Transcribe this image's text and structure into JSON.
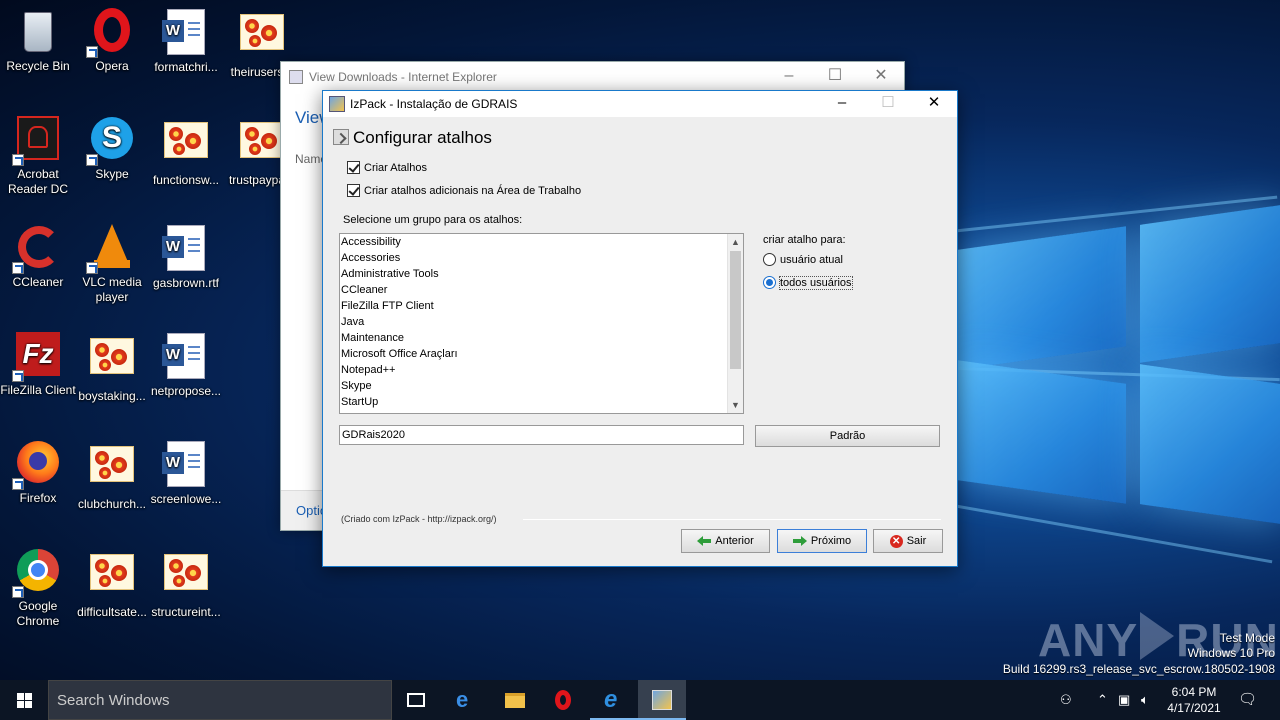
{
  "desktop": {
    "icons": [
      {
        "label": "Recycle Bin"
      },
      {
        "label": "Opera"
      },
      {
        "label": "formatchri..."
      },
      {
        "label": "theirusers..."
      },
      {
        "label": "Acrobat Reader DC"
      },
      {
        "label": "Skype"
      },
      {
        "label": "functionsw..."
      },
      {
        "label": "trustpaypa..."
      },
      {
        "label": "CCleaner"
      },
      {
        "label": "VLC media player"
      },
      {
        "label": "gasbrown.rtf"
      },
      {
        "label": "FileZilla Client"
      },
      {
        "label": "boystaking..."
      },
      {
        "label": "netpropose..."
      },
      {
        "label": "Firefox"
      },
      {
        "label": "clubchurch..."
      },
      {
        "label": "screenlowe..."
      },
      {
        "label": "Google Chrome"
      },
      {
        "label": "difficultsate..."
      },
      {
        "label": "structureint..."
      }
    ]
  },
  "ie_window": {
    "title": "View Downloads - Internet Explorer",
    "heading": "View",
    "column": "Name",
    "footer_link": "Optio"
  },
  "izpack": {
    "title": "IzPack - Instalação de GDRAIS",
    "page_title": "Configurar atalhos",
    "create_shortcuts": "Criar Atalhos",
    "create_desktop": "Criar atalhos adicionais na Área de Trabalho",
    "group_label": "Selecione um grupo para os atalhos:",
    "groups": [
      "Accessibility",
      "Accessories",
      "Administrative Tools",
      "CCleaner",
      "FileZilla FTP Client",
      "Java",
      "Maintenance",
      "Microsoft Office Araçları",
      "Notepad++",
      "Skype",
      "StartUp"
    ],
    "for_label": "criar atalho para:",
    "option_current": "usuário atual",
    "option_all": "todos usuários",
    "group_value": "GDRais2020",
    "default_button": "Padrão",
    "credit": "(Criado com IzPack - http://izpack.org/)",
    "back_button": "Anterior",
    "next_button": "Próximo",
    "quit_button": "Sair"
  },
  "watermark": {
    "brand_left": "ANY",
    "brand_right": "RUN",
    "mode": "Test Mode",
    "os": "Windows 10 Pro",
    "build": "Build 16299.rs3_release_svc_escrow.180502-1908"
  },
  "taskbar": {
    "search_placeholder": "Search Windows",
    "time": "6:04 PM",
    "date": "4/17/2021"
  }
}
